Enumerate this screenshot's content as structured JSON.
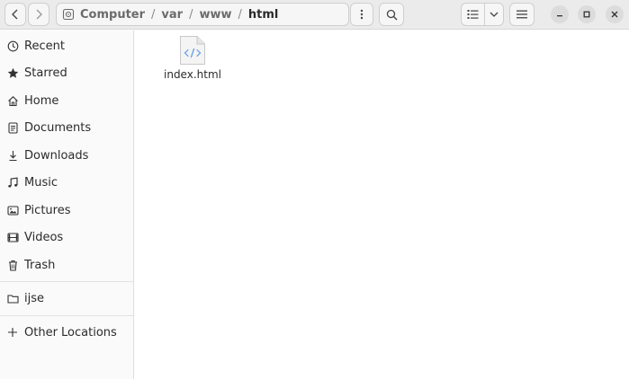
{
  "nav": {
    "back_icon": "chevron-left-icon",
    "forward_icon": "chevron-right-icon"
  },
  "pathbar": {
    "drive_icon": "drive-icon",
    "segments": [
      "Computer",
      "var",
      "www",
      "html"
    ],
    "separator": "/"
  },
  "toolbar": {
    "menu_icon": "vertical-dots-icon",
    "search_icon": "search-icon",
    "view_list_icon": "list-view-icon",
    "view_options_icon": "chevron-down-icon",
    "main_menu_icon": "hamburger-icon"
  },
  "window_controls": [
    "minimize-icon",
    "maximize-icon",
    "close-icon"
  ],
  "sidebar": {
    "items": [
      {
        "label": "Recent",
        "icon": "clock-icon"
      },
      {
        "label": "Starred",
        "icon": "star-icon"
      },
      {
        "label": "Home",
        "icon": "home-icon"
      },
      {
        "label": "Documents",
        "icon": "document-icon"
      },
      {
        "label": "Downloads",
        "icon": "download-icon"
      },
      {
        "label": "Music",
        "icon": "music-icon"
      },
      {
        "label": "Pictures",
        "icon": "picture-icon"
      },
      {
        "label": "Videos",
        "icon": "video-icon"
      },
      {
        "label": "Trash",
        "icon": "trash-icon"
      }
    ],
    "bookmarks": [
      {
        "label": "ijse",
        "icon": "folder-icon"
      }
    ],
    "other": {
      "label": "Other Locations",
      "icon": "plus-icon"
    }
  },
  "files": [
    {
      "name": "index.html",
      "icon": "html-file-icon"
    }
  ],
  "colors": {
    "accent": "#3584e4",
    "headerbar": "#ebebeb",
    "sidebar": "#fafafa"
  }
}
